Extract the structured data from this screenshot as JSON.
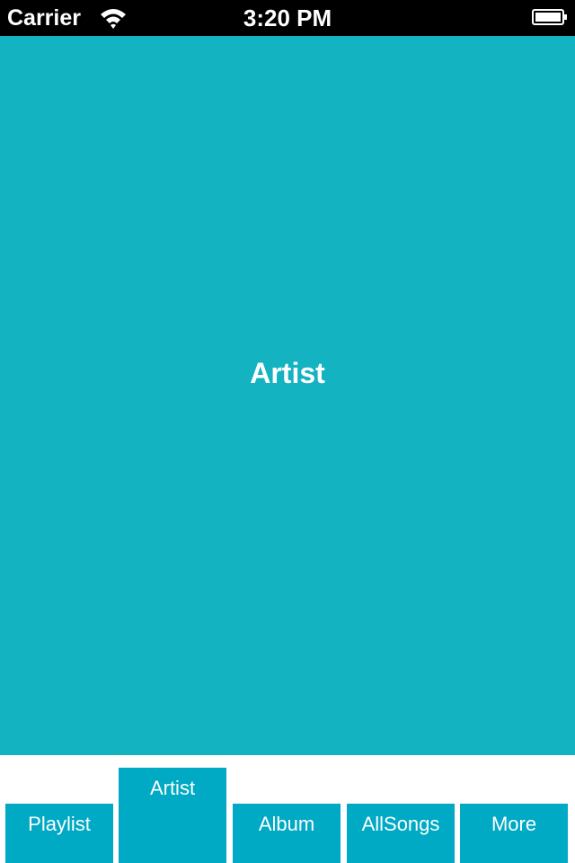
{
  "status_bar": {
    "carrier": "Carrier",
    "time": "3:20 PM",
    "icons": [
      "wifi-icon",
      "battery-icon"
    ]
  },
  "main": {
    "title": "Artist",
    "background_color": "#13b3c2"
  },
  "tab_bar": {
    "accent_color": "#00a9c4",
    "selected_index": 1,
    "tabs": [
      {
        "label": "Playlist"
      },
      {
        "label": "Artist"
      },
      {
        "label": "Album"
      },
      {
        "label": "AllSongs"
      },
      {
        "label": "More"
      }
    ]
  }
}
